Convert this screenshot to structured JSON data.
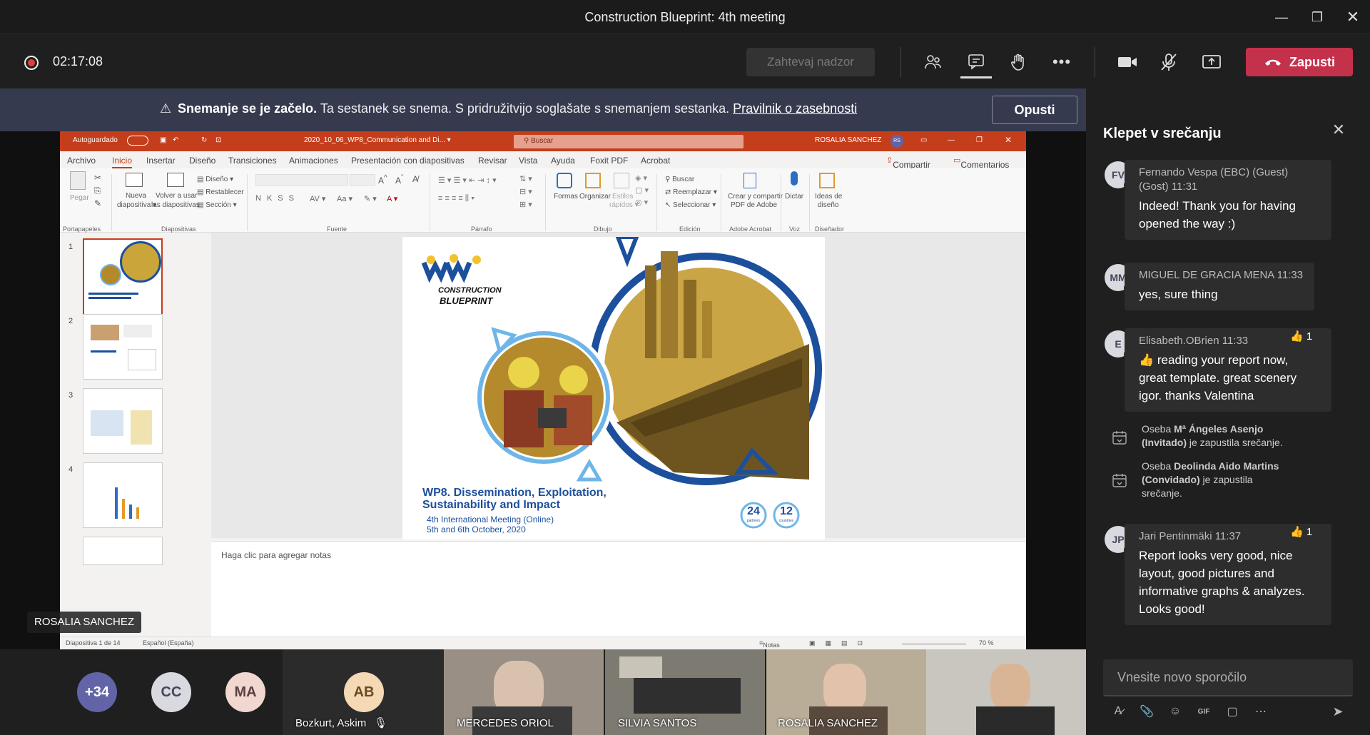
{
  "window": {
    "title": "Construction Blueprint: 4th meeting"
  },
  "toolbar": {
    "timer": "02:17:08",
    "request_control_label": "Zahtevaj nadzor",
    "leave_label": "Zapusti",
    "icons": [
      "participants-icon",
      "chat-icon",
      "raise-hand-icon",
      "more-icon",
      "camera-icon",
      "mic-muted-icon",
      "share-icon",
      "phone-icon"
    ]
  },
  "banner": {
    "strong": "Snemanje se je začelo.",
    "text": "Ta sestanek se snema. S pridružitvijo soglašate s snemanjem sestanka.",
    "link": "Pravilnik o zasebnosti",
    "dismiss_label": "Opusti"
  },
  "ppt": {
    "autosave": "Autoguardado",
    "filename": "2020_10_06_WP8_Communication and Di... ▾",
    "search": "Buscar",
    "user": "ROSALIA SANCHEZ",
    "user_initials": "RS",
    "menus": [
      "Archivo",
      "Inicio",
      "Insertar",
      "Diseño",
      "Transiciones",
      "Animaciones",
      "Presentación con diapositivas",
      "Revisar",
      "Vista",
      "Ayuda",
      "Foxit PDF",
      "Acrobat"
    ],
    "share": "Compartir",
    "comments": "Comentarios",
    "ribbon": {
      "pegar": "Pegar",
      "nueva1": "Nueva",
      "nueva2": "diapositiva ▾",
      "volver1": "Volver a usar",
      "volver2": "las diapositivas",
      "diseno": "Diseño ▾",
      "restablecer": "Restablecer",
      "seccion": "Sección ▾",
      "formas": "Formas",
      "organizar": "Organizar",
      "estilos1": "Estilos",
      "estilos2": "rápidos ▾",
      "buscar": "Buscar",
      "reemplazar": "Reemplazar ▾",
      "seleccionar": "Seleccionar ▾",
      "crear1": "Crear y compartir",
      "crear2": "PDF de Adobe",
      "dictar": "Dictar",
      "ideas1": "Ideas de",
      "ideas2": "diseño",
      "groups": [
        "Portapapeles",
        "Diapositivas",
        "Fuente",
        "Párrafo",
        "Dibujo",
        "Edición",
        "Adobe Acrobat",
        "Voz",
        "Diseñador"
      ]
    },
    "thumb_numbers": [
      "1",
      "2",
      "3",
      "4"
    ],
    "slide": {
      "logo1": "CONSTRUCTION",
      "logo2": "BLUEPRINT",
      "title1": "WP8. Dissemination, Exploitation,",
      "title2": "Sustainability and Impact",
      "sub1": "4th International Meeting (Online)",
      "sub2": "5th and 6th October, 2020",
      "badge1": "24",
      "badge1_sub": "partners",
      "badge2": "12",
      "badge2_sub": "countries"
    },
    "notes_placeholder": "Haga clic para agregar notas",
    "status_slide": "Diapositiva 1 de 14",
    "status_lang": "Español (España)",
    "status_notes": "Notas",
    "status_zoom": "70 %"
  },
  "presenter_tag": "ROSALIA SANCHEZ",
  "gallery": {
    "more": "+34",
    "avatars": [
      "CC",
      "MA",
      "AB"
    ],
    "ab_name": "Bozkurt, Askim",
    "tiles": [
      "MERCEDES ORIOL",
      "SILVIA SANTOS",
      "ROSALIA SANCHEZ"
    ]
  },
  "chat": {
    "title": "Klepet v srečanju",
    "messages": [
      {
        "initials": "FV",
        "meta": "Fernando Vespa (EBC) (Guest)",
        "meta2": "(Gost)   11:31",
        "lines": [
          "Indeed! Thank you for having",
          "opened the way :)"
        ]
      },
      {
        "initials": "MM",
        "meta": "MIGUEL DE GRACIA MENA   11:33",
        "lines": [
          "yes, sure thing"
        ]
      },
      {
        "initials": "E",
        "meta": "Elisabeth.OBrien   11:33",
        "reaction": "👍 1",
        "lines": [
          "👍 reading your report now,",
          "great template. great scenery",
          "igor. thanks Valentina"
        ]
      },
      {
        "initials": "JP",
        "meta": "Jari Pentinmäki   11:37",
        "reaction": "👍 1",
        "lines": [
          "Report looks very good, nice",
          "layout, good pictures and",
          "informative graphs & analyzes.",
          "Looks good!"
        ]
      }
    ],
    "system": [
      {
        "pre": "Oseba ",
        "name": "Mª Ángeles Asenjo",
        "name2": "(Invitado)",
        "post": " je zapustila srečanje."
      },
      {
        "pre": "Oseba ",
        "name": "Deolinda Aido Martins",
        "name2": "(Convidado)",
        "post": " je zapustila",
        "post2": "srečanje."
      }
    ],
    "compose_placeholder": "Vnesite novo sporočilo"
  }
}
